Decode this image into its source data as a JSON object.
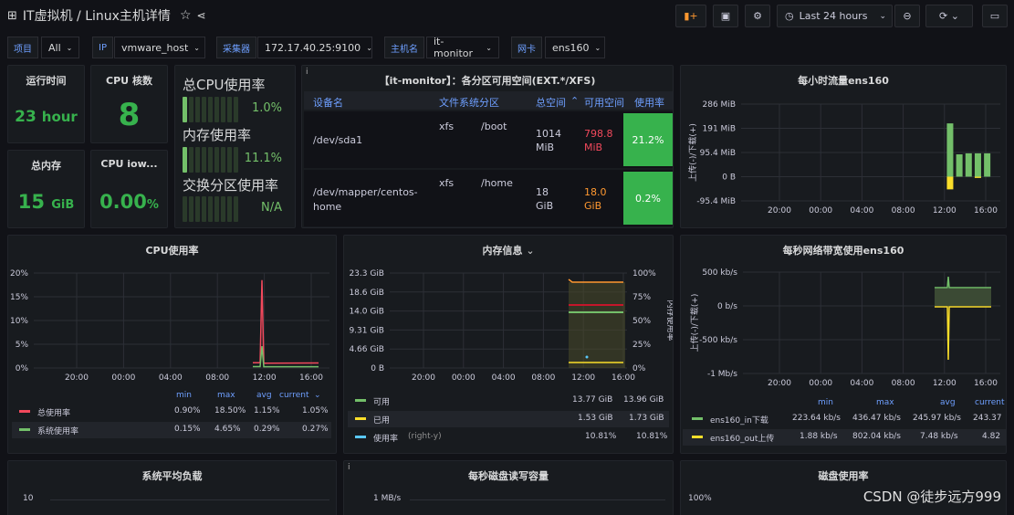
{
  "header": {
    "breadcrumb": "IT虚拟机 / Linux主机详情",
    "time_range": "Last 24 hours"
  },
  "variables": [
    {
      "label": "项目",
      "value": "All"
    },
    {
      "label": "IP",
      "value": "vmware_host"
    },
    {
      "label": "采集器",
      "value": "172.17.40.25:9100"
    },
    {
      "label": "主机名",
      "value": "it-monitor"
    },
    {
      "label": "网卡",
      "value": "ens160"
    }
  ],
  "stats": {
    "uptime": {
      "title": "运行时间",
      "value": "23",
      "unit": "hour"
    },
    "cpu_cores": {
      "title": "CPU 核数",
      "value": "8"
    },
    "mem_total": {
      "title": "总内存",
      "value": "15",
      "unit": "GiB"
    },
    "cpu_iowait": {
      "title": "CPU iow...",
      "value": "0.00",
      "unit": "%"
    }
  },
  "gauges": [
    {
      "label": "总CPU使用率",
      "value": "1.0%",
      "fraction": 0.01
    },
    {
      "label": "内存使用率",
      "value": "11.1%",
      "fraction": 0.111
    },
    {
      "label": "交换分区使用率",
      "value": "N/A",
      "fraction": 0
    }
  ],
  "partition_table": {
    "title": "【it-monitor】：各分区可用空间(EXT.*/XFS)",
    "columns": [
      "设备名",
      "文件系统分区",
      "总空间",
      "可用空间",
      "使用率"
    ],
    "rows": [
      {
        "device": "/dev/sda1",
        "fs": "xfs",
        "mount": "/boot",
        "total": "1014 MiB",
        "avail": "798.8 MiB",
        "usage": "21.2%",
        "avail_color": "#f2495c"
      },
      {
        "device": "/dev/mapper/centos-home",
        "fs": "xfs",
        "mount": "/home",
        "total": "18 GiB",
        "avail": "18.0 GiB",
        "usage": "0.2%",
        "avail_color": "#ff9830"
      }
    ]
  },
  "watermark": "CSDN @徒步远方999",
  "chart_data": [
    {
      "type": "bar",
      "title": "每小时流量ens160",
      "ylabel": "上传(-)/下载(+)",
      "yticks": [
        "286 MiB",
        "191 MiB",
        "95.4 MiB",
        "0 B",
        "-95.4 MiB"
      ],
      "xticks": [
        "20:00",
        "00:00",
        "04:00",
        "08:00",
        "12:00",
        "16:00"
      ],
      "ylim": [
        -95.4,
        286
      ],
      "x": [
        12.5,
        13.4,
        14.3,
        15.2,
        16.1
      ],
      "series": [
        {
          "values": [
            210,
            88,
            92,
            92,
            92
          ]
        },
        {
          "values": [
            -50,
            0,
            0,
            -5,
            0
          ]
        }
      ]
    },
    {
      "type": "line",
      "title": "CPU使用率",
      "yticks": [
        "20%",
        "15%",
        "10%",
        "5%",
        "0%"
      ],
      "xticks": [
        "20:00",
        "00:00",
        "04:00",
        "08:00",
        "12:00",
        "16:00"
      ],
      "ylim": [
        0,
        20
      ],
      "legend_headers": [
        "min",
        "max",
        "avg",
        "current"
      ],
      "series": [
        {
          "name": "总使用率",
          "color": "#f2495c",
          "min": "0.90%",
          "max": "18.50%",
          "avg": "1.15%",
          "current": "1.05%"
        },
        {
          "name": "系统使用率",
          "color": "#73bf69",
          "min": "0.15%",
          "max": "4.65%",
          "avg": "0.29%",
          "current": "0.27%"
        }
      ]
    },
    {
      "type": "line",
      "title": "内存信息",
      "yticks": [
        "23.3 GiB",
        "18.6 GiB",
        "14.0 GiB",
        "9.31 GiB",
        "4.66 GiB",
        "0 B"
      ],
      "y2ticks": [
        "100%",
        "75%",
        "50%",
        "25%",
        "0%"
      ],
      "y2label": "内存使用率",
      "xticks": [
        "20:00",
        "00:00",
        "04:00",
        "08:00",
        "12:00",
        "16:00"
      ],
      "series": [
        {
          "name": "可用",
          "color": "#73bf69",
          "v1": "13.77 GiB",
          "v2": "13.96 GiB"
        },
        {
          "name": "已用",
          "color": "#fade2a",
          "v1": "1.53 GiB",
          "v2": "1.73 GiB"
        },
        {
          "name": "使用率",
          "suffix": "(right-y)",
          "color": "#5ac8fa",
          "v1": "10.81%",
          "v2": "10.81%"
        }
      ]
    },
    {
      "type": "line",
      "title": "每秒网络带宽使用ens160",
      "ylabel": "上传(-)/下载(+)",
      "yticks": [
        "500 kb/s",
        "0 b/s",
        "-500 kb/s",
        "-1 Mb/s"
      ],
      "xticks": [
        "20:00",
        "00:00",
        "04:00",
        "08:00",
        "12:00",
        "16:00"
      ],
      "legend_headers": [
        "min",
        "max",
        "avg",
        "current"
      ],
      "series": [
        {
          "name": "ens160_in下载",
          "color": "#73bf69",
          "min": "223.64 kb/s",
          "max": "436.47 kb/s",
          "avg": "245.97 kb/s",
          "current": "243.37"
        },
        {
          "name": "ens160_out上传",
          "color": "#fade2a",
          "min": "1.88 kb/s",
          "max": "802.04 kb/s",
          "avg": "7.48 kb/s",
          "current": "4.82"
        }
      ]
    },
    {
      "type": "line",
      "title": "系统平均负载",
      "yticks": [
        "10"
      ]
    },
    {
      "type": "line",
      "title": "每秒磁盘读写容量",
      "yticks": [
        "1 MB/s"
      ]
    },
    {
      "type": "line",
      "title": "磁盘使用率",
      "yticks": [
        "100%"
      ]
    }
  ]
}
